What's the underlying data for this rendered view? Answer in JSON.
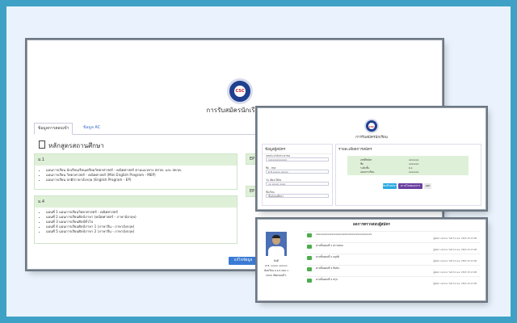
{
  "main_window": {
    "logo_text": "CSC",
    "title": "การรับสมัครนักเรียน",
    "tabs": [
      "ข้อมูลการสอบเข้า",
      "ข้อมูล AC"
    ],
    "section_heading": "หลักสูตรสถานศึกษา",
    "cards": [
      {
        "header": "ม.1",
        "items": [
          "แผนการเรียน นักเรียนเรียนเตรียมวิทยาศาสตร์ - คณิตศาสตร์ ตามแนวทาง สสวท. และ สควค.",
          "แผนการเรียน วิทยาศาสตร์ - คณิตศาสตร์ (Mini English Program - MEP)",
          "แผนการเรียน ปกติ/ภาษาอังกฤษ (English Program - EP)"
        ]
      },
      {
        "header": "ม.4",
        "items": [
          "แผนที่ 1 แผนการเรียนวิทยาศาสตร์ - คณิตศาสตร์",
          "แผนที่ 2 แผนการเรียนศิลป์ภาษา (คณิตศาสตร์ - ภาษาอังกฤษ)",
          "แผนที่ 3 แผนการเรียนศิลป์ทั่วไป",
          "แผนที่ 4 แผนการเรียนศิลป์ภาษา 1 (ภาษาจีน - ภาษาอังกฤษ)",
          "แผนที่ 5 แผนการเรียนศิลป์ภาษา 2 (ภาษาจีน - ภาษาอังกฤษ)"
        ]
      }
    ],
    "right_cards": [
      "EP",
      "EP"
    ],
    "edit_button": "แก้ไขข้อมูล"
  },
  "registration_window": {
    "logo_text": "CSC",
    "title": "การรับสมัครนักเรียน",
    "left_heading": "ข้อมูลผู้สมัคร",
    "fields": [
      {
        "label": "เลขประจำตัวประชาชน",
        "value": "1xxxxxxxxxxxx"
      },
      {
        "label": "ชื่อ - สกุล",
        "value": "ด.ช.xxxxx xxxxx"
      },
      {
        "label": "วัน เดือน ปีเกิด",
        "value": "xx xxxxx xxxx"
      },
      {
        "label": "ชั้นเรียน",
        "value": "ชั้นมัธยมศึกษา"
      }
    ],
    "right_heading": "รายละเอียดการสมัคร",
    "panel_rows": [
      "เลขที่สมัคร",
      "ชื่อ",
      "ระดับชั้น",
      "แผนการเรียน"
    ],
    "panel_values": [
      "xxxxxxx",
      "xxxxxxx",
      "ม.1",
      "xxxxxxx"
    ],
    "buttons": [
      "พิมพ์ใบสมัคร",
      "ดาวน์โหลดเอกสาร",
      "ออก"
    ],
    "colors": {
      "btn1": "#29a9e0",
      "btn2": "#6a3fa0",
      "btn3": "#e8e8e8"
    }
  },
  "results_window": {
    "title": "ผลการตรวจสอบผู้สมัคร",
    "student": {
      "line1": "ยินดี",
      "line2": "ด.ช. xxxxx xxxxxx",
      "line3": "ห้องเรียน ม.1/1 แผน 1",
      "line4": "2020 เลือกแผนที่ 1"
    },
    "messages": [
      {
        "text": "xxxxxxxxxxxxxxxxxxxxxxxxxxxxxxxxxxxxxxx",
        "meta": "ผู้สมัคร xxxxxx วันที่ 14 พ.ค. 2563 15:13:08"
      },
      {
        "text": "ผ่านขั้นตอนที่ 1 ตรวจสอบ",
        "meta": "ผู้สมัคร xxxxxx วันที่ 14 พ.ค. 2563 15:13:08"
      },
      {
        "text": "ผ่านขั้นตอนที่ 2 อนุมัติ",
        "meta": "ผู้สมัคร xxxxxx วันที่ 14 พ.ค. 2563 15:13:08"
      },
      {
        "text": "ผ่านขั้นตอนที่ 3 ยืนยัน",
        "meta": "ผู้สมัคร xxxxxx วันที่ 14 พ.ค. 2563 15:13:08"
      },
      {
        "text": "ผ่านขั้นตอนที่ 4 สรุป",
        "meta": "ผู้สมัคร xxxxxx วันที่ 14 พ.ค. 2563 15:13:08"
      }
    ]
  }
}
